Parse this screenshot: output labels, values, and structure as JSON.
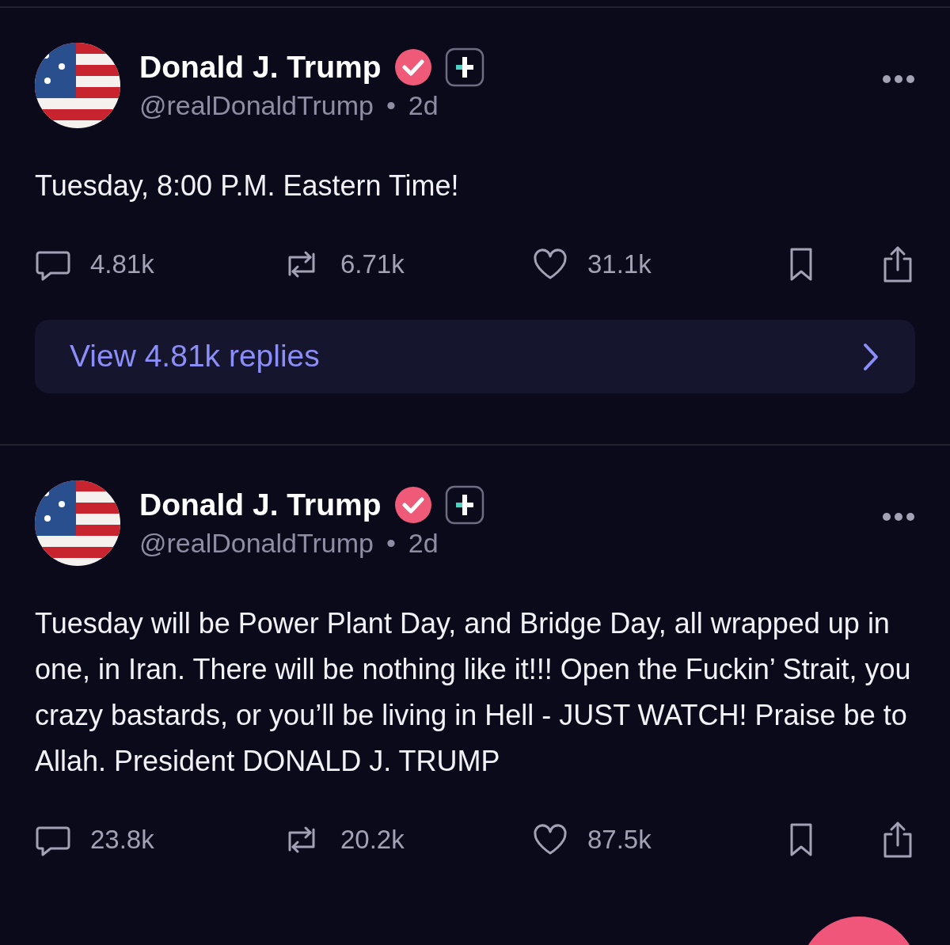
{
  "posts": [
    {
      "author": {
        "name": "Donald J. Trump",
        "verified": true,
        "handle": "@realDonaldTrump",
        "separator": "•",
        "time": "2d"
      },
      "text": "Tuesday, 8:00 P.M. Eastern Time!",
      "stats": {
        "replies": "4.81k",
        "reposts": "6.71k",
        "likes": "31.1k"
      },
      "view_replies": "View 4.81k replies"
    },
    {
      "author": {
        "name": "Donald J. Trump",
        "verified": true,
        "handle": "@realDonaldTrump",
        "separator": "•",
        "time": "2d"
      },
      "text": "Tuesday will be Power Plant Day, and Bridge Day, all wrapped up in one, in Iran. There will be nothing like it!!! Open the Fuckin’ Strait, you crazy bastards, or you’ll be living in Hell - JUST WATCH! Praise be to Allah. President DONALD J. TRUMP",
      "stats": {
        "replies": "23.8k",
        "reposts": "20.2k",
        "likes": "87.5k"
      }
    }
  ],
  "fab": {
    "kind": "floating"
  }
}
